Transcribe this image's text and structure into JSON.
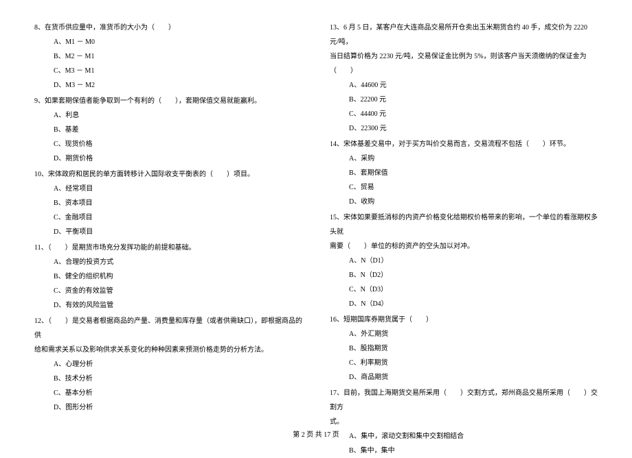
{
  "left": {
    "q8": {
      "text": "8、在货币供应量中，准货币的大小为（　　）",
      "a": "A、M1 － M0",
      "b": "B、M2 － M1",
      "c": "C、M3 － M1",
      "d": "D、M3 － M2"
    },
    "q9": {
      "text": "9、如果套期保值者能争取到一个有利的（　　），套期保值交易就能赢利。",
      "a": "A、利息",
      "b": "B、基差",
      "c": "C、现货价格",
      "d": "D、期货价格"
    },
    "q10": {
      "text": "10、宋体政府和居民的单方面转移计入国际收支平衡表的（　　）项目。",
      "a": "A、经常项目",
      "b": "B、资本项目",
      "c": "C、金融项目",
      "d": "D、平衡项目"
    },
    "q11": {
      "text": "11、（　　）是期货市场充分发挥功能的前提和基础。",
      "a": "A、合理的投资方式",
      "b": "B、健全的组织机构",
      "c": "C、资金的有效监管",
      "d": "D、有效的风险监管"
    },
    "q12": {
      "text1": "12、（　　）是交易者根据商品的产量、消费量和库存量（或者供需缺口），即根据商品的供",
      "text2": "给和需求关系以及影响供求关系变化的种种因素来预测价格走势的分析方法。",
      "a": "A、心理分析",
      "b": "B、技术分析",
      "c": "C、基本分析",
      "d": "D、图形分析"
    }
  },
  "right": {
    "q13": {
      "text1": "13、6 月 5 日，某客户在大连商品交易所开仓卖出玉米期货合约 40 手，成交价为 2220 元/吨，",
      "text2": "当日结算价格为 2230 元/吨，交易保证金比例为 5%，则该客户当天须缴纳的保证金为（　　）",
      "a": "A、44600 元",
      "b": "B、22200 元",
      "c": "C、44400 元",
      "d": "D、22300 元"
    },
    "q14": {
      "text": "14、宋体基差交易中，对于买方叫价交易而言，交易流程不包括（　　）环节。",
      "a": "A、采购",
      "b": "B、套期保值",
      "c": "C、贸易",
      "d": "D、收购"
    },
    "q15": {
      "text1": "15、宋体如果要抵消标的内资产价格变化给期权价格带来的影响，一个单位的看涨期权多头就",
      "text2": "需要（　　）单位的标的资产的空头加以对冲。",
      "a": "A、N（D1）",
      "b": "B、N（D2）",
      "c": "C、N（D3）",
      "d": "D、N（D4）"
    },
    "q16": {
      "text": "16、短期国库券期货属于（　　）",
      "a": "A、外汇期货",
      "b": "B、股指期货",
      "c": "C、利率期货",
      "d": "D、商品期货"
    },
    "q17": {
      "text1": "17、目前，我国上海期货交易所采用（　　）交割方式，郑州商品交易所采用（　　）交割方",
      "text2": "式。",
      "a": "A、集中，滚动交割和集中交割相结合",
      "b": "B、集中，集中"
    }
  },
  "footer": "第 2 页 共 17 页"
}
